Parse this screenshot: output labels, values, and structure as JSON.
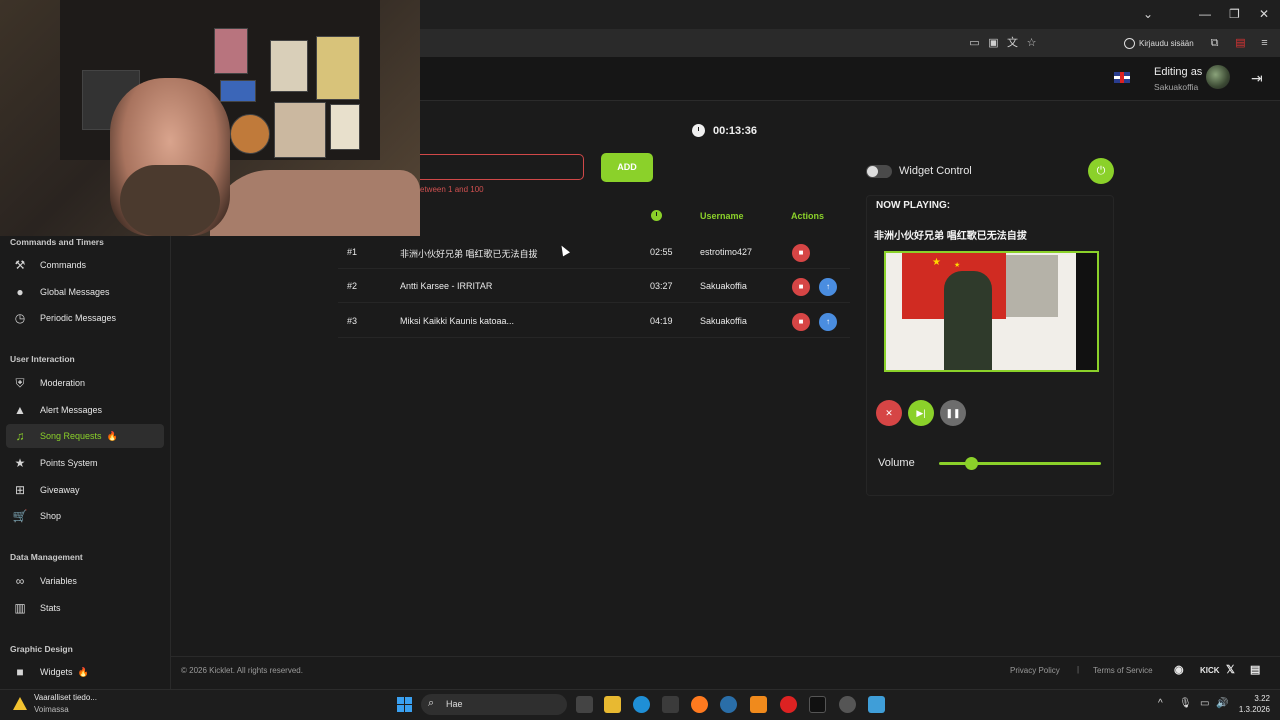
{
  "browser": {
    "login_label": "Kirjaudu sisään",
    "window_controls": [
      "⌄",
      "—",
      "❐",
      "✕"
    ]
  },
  "header": {
    "editing_label": "Editing as",
    "username": "Sakuakoffia",
    "language": "English (UK)"
  },
  "sidebar": {
    "sections": [
      {
        "title": "Commands and Timers",
        "items": [
          {
            "label": "Commands",
            "icon": "wrench-icon"
          },
          {
            "label": "Global Messages",
            "icon": "chat-icon"
          },
          {
            "label": "Periodic Messages",
            "icon": "clock-icon"
          }
        ]
      },
      {
        "title": "User Interaction",
        "items": [
          {
            "label": "Moderation",
            "icon": "shield-icon"
          },
          {
            "label": "Alert Messages",
            "icon": "warning-icon"
          },
          {
            "label": "Song Requests",
            "icon": "music-icon",
            "active": true
          },
          {
            "label": "Points System",
            "icon": "star-icon"
          },
          {
            "label": "Giveaway",
            "icon": "gift-icon"
          },
          {
            "label": "Shop",
            "icon": "cart-icon"
          }
        ]
      },
      {
        "title": "Data Management",
        "items": [
          {
            "label": "Variables",
            "icon": "link-icon"
          },
          {
            "label": "Stats",
            "icon": "bar-chart-icon"
          }
        ]
      },
      {
        "title": "Graphic Design",
        "items": [
          {
            "label": "Widgets",
            "icon": "video-icon"
          }
        ]
      }
    ]
  },
  "queue": {
    "timer": "00:13:36",
    "input_hint": "etween 1 and 100",
    "add_label": "ADD",
    "headers": {
      "username": "Username",
      "actions": "Actions"
    },
    "rows": [
      {
        "pos": "#1",
        "title": "非洲小伙好兄弟 唱红歌已无法自拔",
        "duration": "02:55",
        "user": "estrotimo427"
      },
      {
        "pos": "#2",
        "title": "Antti Karsee - IRRITAR",
        "duration": "03:27",
        "user": "Sakuakoffia"
      },
      {
        "pos": "#3",
        "title": "Miksi Kaikki Kaunis katoaa...",
        "duration": "04:19",
        "user": "Sakuakoffia"
      }
    ]
  },
  "widget": {
    "control_label": "Widget Control",
    "now_playing_label": "NOW PLAYING:",
    "now_playing_title": "非洲小伙好兄弟 唱红歌已无法自拔",
    "volume_label": "Volume",
    "volume_fraction": 0.2,
    "enabled": false
  },
  "footer": {
    "copyright": "© 2026 Kicklet. All rights reserved.",
    "privacy": "Privacy Policy",
    "separator": "|",
    "terms": "Terms of Service",
    "kick": "KICK"
  },
  "taskbar": {
    "alert_title": "Vaaralliset tiedo...",
    "alert_sub": "Voimassa",
    "search_placeholder": "Hae",
    "time": "3.22",
    "date": "1.3.2026"
  },
  "colors": {
    "accent": "#8bd12a",
    "danger": "#d64545",
    "info": "#4a8de0"
  }
}
